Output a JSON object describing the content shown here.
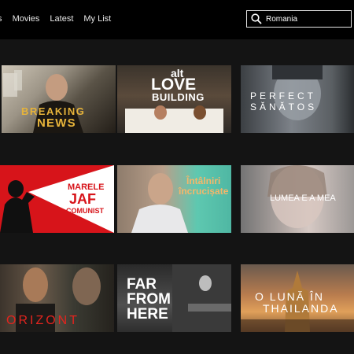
{
  "nav": {
    "items": [
      "ows",
      "Movies",
      "Latest",
      "My List"
    ]
  },
  "search": {
    "value": "Romania"
  },
  "rows": [
    [
      {
        "title_line1": "BREAKING",
        "title_line2": "NEWS"
      },
      {
        "title_line1": "alt",
        "title_line2": "LOVE",
        "title_line3": "BUILDING"
      },
      {
        "title_line1": "PERFECT",
        "title_line2": "SĂNĂTOS"
      }
    ],
    [
      {
        "title_line1": "MARELE",
        "title_line2": "JAF",
        "title_line3": "COMUNIST"
      },
      {
        "title_line1": "Întâlniri",
        "title_line2": "încrucișate"
      },
      {
        "title_line1": "LUMEA E A MEA"
      }
    ],
    [
      {
        "title_line1": "ORIZONT"
      },
      {
        "title_line1": "FAR",
        "title_line2": "FROM",
        "title_line3": "HERE"
      },
      {
        "title_line1": "O LUNĂ ÎN",
        "title_line2": "THAILANDA"
      }
    ]
  ],
  "colors": {
    "background": "#141414",
    "topbar": "#000000",
    "accent_red": "#d7141a",
    "gold_text": "#e6b33a",
    "green_text": "#f5b66a"
  }
}
